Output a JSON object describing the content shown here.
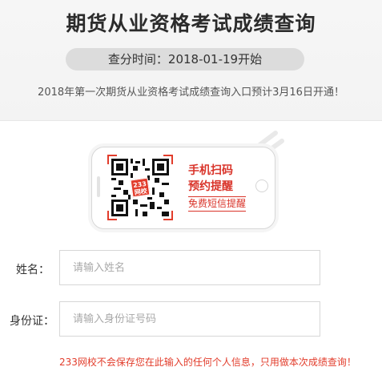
{
  "header": {
    "title": "期货从业资格考试成绩查询",
    "time_label": "查分时间：2018-01-19开始",
    "notice": "2018年第一次期货从业资格考试成绩查询入口预计3月16日开通！"
  },
  "promo": {
    "qr_badge": "233网校",
    "line1": "手机扫码",
    "line2": "预约提醒",
    "sms_link": "免费短信提醒"
  },
  "form": {
    "name_label": "姓名：",
    "name_placeholder": "请输入姓名",
    "id_label": "身份证：",
    "id_placeholder": "请输入身份证号码",
    "privacy_note": "233网校不会保存您在此输入的任何个人信息，只用做本次成绩查询！"
  },
  "colors": {
    "accent": "#e23c2b",
    "pill": "#dcdcdc",
    "header_bg": "#f4f4f4"
  }
}
